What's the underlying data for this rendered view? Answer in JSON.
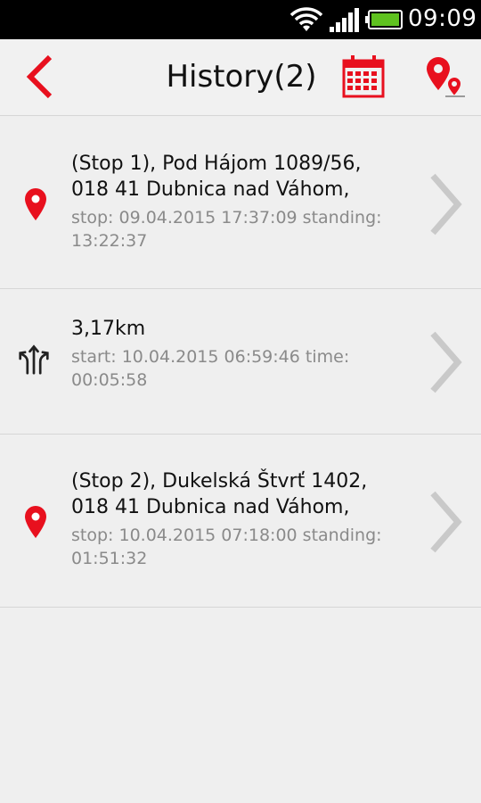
{
  "status_bar": {
    "time": "09:09",
    "icons": [
      "wifi-icon",
      "signal-icon",
      "battery-icon"
    ]
  },
  "header": {
    "title": "History(2)",
    "back_icon": "chevron-left-icon",
    "calendar_icon": "calendar-icon",
    "map_icon": "map-pins-icon",
    "accent_color": "#e8101e"
  },
  "items": [
    {
      "type": "stop",
      "icon": "map-pin-icon",
      "address_line1": "(Stop 1), Pod Hájom 1089/56,",
      "address_line2": "018 41 Dubnica nad Váhom,",
      "detail_line1": "stop: 09.04.2015  17:37:09 standing:",
      "detail_line2": "13:22:37"
    },
    {
      "type": "trip",
      "icon": "route-arrows-icon",
      "distance": "3,17km",
      "detail_line1": "start: 10.04.2015  06:59:46 time:",
      "detail_line2": "00:05:58"
    },
    {
      "type": "stop",
      "icon": "map-pin-icon",
      "address_line1": "(Stop 2), Dukelská Štvrť 1402,",
      "address_line2": "018 41 Dubnica nad Váhom,",
      "detail_line1": "stop: 10.04.2015  07:18:00 standing:",
      "detail_line2": "01:51:32"
    }
  ]
}
